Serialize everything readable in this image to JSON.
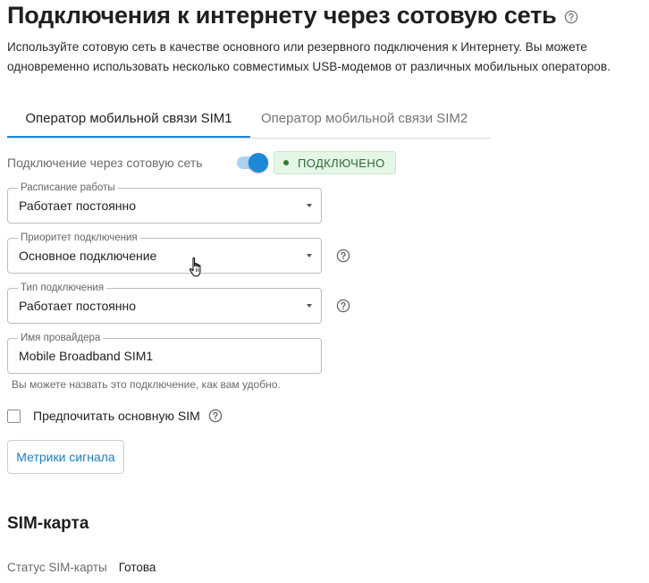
{
  "page": {
    "title": "Подключения к интернету через сотовую сеть",
    "description": "Используйте сотовую сеть в качестве основного или резервного подключения к Интернету. Вы можете одновременно использовать несколько совместимых USB-модемов от различных мобильных операторов."
  },
  "tabs": [
    {
      "label": "Оператор мобильной связи SIM1",
      "active": true
    },
    {
      "label": "Оператор мобильной связи SIM2",
      "active": false
    }
  ],
  "connection": {
    "label": "Подключение через сотовую сеть",
    "enabled": true,
    "status": "ПОДКЛЮЧЕНО"
  },
  "fields": {
    "schedule": {
      "label": "Расписание работы",
      "value": "Работает постоянно"
    },
    "priority": {
      "label": "Приоритет подключения",
      "value": "Основное подключение"
    },
    "type": {
      "label": "Тип подключения",
      "value": "Работает постоянно"
    },
    "provider": {
      "label": "Имя провайдера",
      "value": "Mobile Broadband SIM1",
      "hint": "Вы можете назвать это подключение, как вам удобно."
    }
  },
  "prefer_sim": {
    "label": "Предпочитать основную SIM",
    "checked": false
  },
  "metrics_button": {
    "label": "Метрики сигнала"
  },
  "sim_section": {
    "title": "SIM-карта",
    "status_label": "Статус SIM-карты",
    "status_value": "Готова"
  },
  "colors": {
    "accent": "#1a8ad8",
    "link": "#1a7fc8",
    "success_bg": "#e4f6e6",
    "success_text": "#2b6b32"
  },
  "icons": {
    "help": "help-circle-icon",
    "dropdown": "triangle-down-icon",
    "cursor": "hand-pointer-icon"
  }
}
